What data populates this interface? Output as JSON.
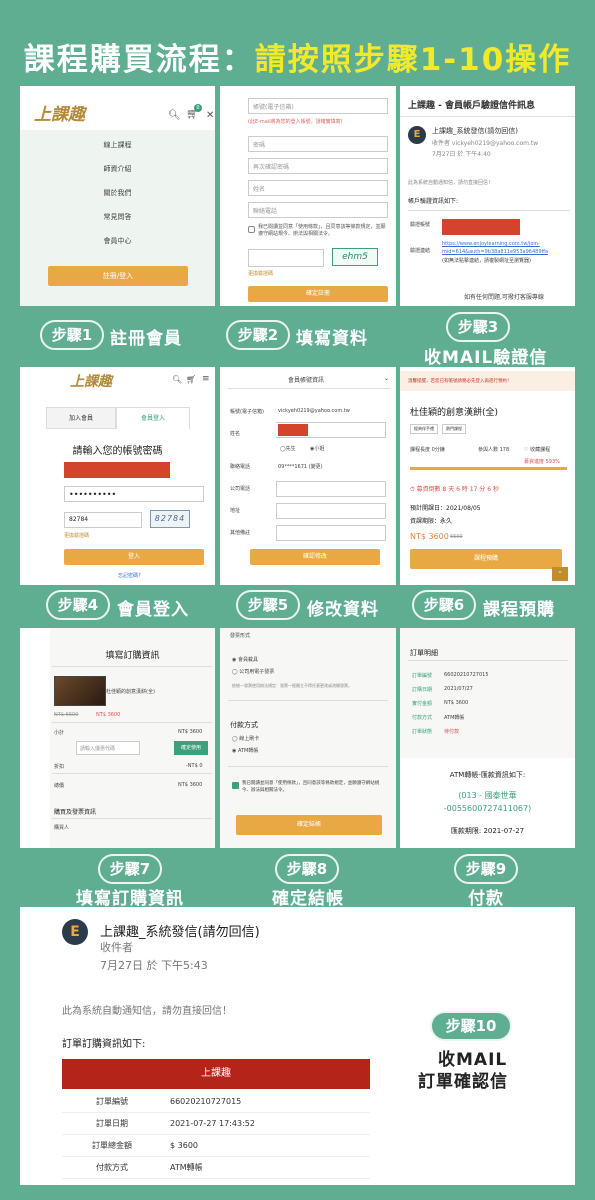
{
  "title": {
    "main": "課程購買流程：",
    "highlight": "請按照步驟1-10操作"
  },
  "steps": {
    "s1": {
      "pill": "步驟1",
      "label": "註冊會員"
    },
    "s2": {
      "pill": "步驟2",
      "label": "填寫資料"
    },
    "s3": {
      "pill": "步驟3",
      "label": "收MAIL驗證信"
    },
    "s4": {
      "pill": "步驟4",
      "label": "會員登入"
    },
    "s5": {
      "pill": "步驟5",
      "label": "修改資料"
    },
    "s6": {
      "pill": "步驟6",
      "label": "課程預購"
    },
    "s7": {
      "pill": "步驟7",
      "label": "填寫訂購資訊"
    },
    "s8": {
      "pill": "步驟8",
      "label": "確定結帳"
    },
    "s9": {
      "pill": "步驟9",
      "label": "付款"
    },
    "s10": {
      "pill": "步驟10",
      "label_line1": "收MAIL",
      "label_line2": "訂單確認信"
    }
  },
  "p1": {
    "logo": "上課趣",
    "cart_count": "0",
    "menu": [
      "線上課程",
      "師資介紹",
      "關於我們",
      "常見問答",
      "會員中心"
    ],
    "register": "註冊/登入"
  },
  "p2": {
    "account_placeholder": "帳號(電子信箱)",
    "hint": "(此E-mail將為您的登入帳號，請確實填寫)",
    "password": "密碼",
    "confirm": "再次確認密碼",
    "name": "姓名",
    "phone": "聯絡電話",
    "agree": "我已閱讀並同意「使用條款」，且同意該等條款規定，並願遵守網站規今、辦法與相關法令。",
    "captcha": "ehm5",
    "refresh": "更換驗證碼",
    "submit": "確定註冊"
  },
  "p3": {
    "subject": "上課趣 - 會員帳戶驗證信件訊息",
    "sender": "上課趣_系統發信(請勿回信)",
    "to": "收件者 vickyeh0219@yahoo.com.tw",
    "time": "7月27日 於 下午4:40",
    "auto": "此為系統自動通知信，請勿直接回信！",
    "info": "帳戶驗證資訊如下:",
    "row1": "驗證帳號",
    "row2": "驗證連結",
    "link1": "https://www.enjoylearning.com.tw/join-",
    "link2": "mid=614&auth=9b38a811e953a96489ffa",
    "note": "(如無法點擊連結，請複製網址至瀏覽器)",
    "help": "如有任何問題,可撥打客服專線"
  },
  "p4": {
    "logo": "上課趣",
    "cart_count": "0",
    "tab_join": "加入會員",
    "tab_login": "會員登入",
    "heading": "請輸入您的帳號密碼",
    "password_mask": "••••••••••",
    "code": "82784",
    "captcha": "82784",
    "refresh": "更換驗證碼",
    "login": "登入",
    "forgot": "忘記密碼?"
  },
  "p5": {
    "header": "會員帳號資訊",
    "account_label": "帳號(電子信箱)",
    "account_value": "vickyeh0219@yahoo.com.tw",
    "name_label": "姓名",
    "gender_m": "先生",
    "gender_f": "小姐",
    "phone_label": "聯絡電話",
    "phone_value": "09****1671 (變更)",
    "company_label": "公司電話",
    "address_label": "地址",
    "other_label": "其他備註",
    "submit": "確認修改"
  },
  "p6": {
    "notice": "溫馨提醒，若您已有帳號請務必先登入再進行預約！",
    "course": "杜佳穎的創意漢餅(全)",
    "tag1": "經典伴手禮",
    "tag2": "熱門課程",
    "stats": "課程長度 0分鐘",
    "students": "參與人數 178",
    "fav": "收藏課程",
    "progress": "募資進度 593%",
    "countdown": "募資倒數 8 天 6 時 17 分 6 秒",
    "start": "預計開課日：2021/08/05",
    "period": "資課期限：永久",
    "price": "NT$ 3600",
    "old_price": "6600",
    "buy": "課程預購"
  },
  "p7": {
    "heading": "填寫訂購資訊",
    "course": "杜佳穎的創意漢餅(全)",
    "old_price": "NT$ 6600",
    "price": "NT$ 3600",
    "subtotal_label": "小計",
    "subtotal": "NT$ 3600",
    "coupon_placeholder": "請輸入優惠代碼",
    "coupon_btn": "確定使用",
    "discount_label": "折扣",
    "discount": "-NT$ 0",
    "total_label": "總價",
    "total": "NT$ 3600",
    "buyer_section": "購買及發票資訊",
    "buyer_label": "購買人"
  },
  "p8": {
    "invoice_label": "發票形式",
    "invoice_opt1": "會員載具",
    "invoice_opt2": "公司用電子發票",
    "invoice_note": "依統一發票使用辦法規定：發票一經開立不得任意更改或改開發票。",
    "pay_label": "付款方式",
    "pay_opt1": "線上刷卡",
    "pay_opt2": "ATM轉帳",
    "agree": "我已閱讀並同意「使用條款」，且同意該等條款規定，並願遵守網站規今、辦法與相關法令。",
    "submit": "確定結帳"
  },
  "p9": {
    "heading": "訂單明細",
    "rows": [
      {
        "k": "訂單編號",
        "v": "66020210727015"
      },
      {
        "k": "訂購日期",
        "v": "2021/07/27"
      },
      {
        "k": "實付金額",
        "v": "NT$ 3600"
      },
      {
        "k": "付款方式",
        "v": "ATM轉帳"
      },
      {
        "k": "訂單狀態",
        "v": "待付款"
      }
    ],
    "atm_title": "ATM轉帳-匯款資訊如下:",
    "bank": "(013 - 國泰世華",
    "account": "-0055600727411067)",
    "deadline": "匯款期限: 2021-07-27"
  },
  "p10": {
    "sender": "上課趣_系統發信(請勿回信)",
    "to": "收件者",
    "time": "7月27日 於 下午5:43",
    "auto": "此為系統自動通知信，請勿直接回信！",
    "info": "訂單訂購資訊如下:",
    "banner": "上課趣",
    "rows": [
      {
        "k": "訂單編號",
        "v": "66020210727015"
      },
      {
        "k": "訂單日期",
        "v": "2021-07-27 17:43:52"
      },
      {
        "k": "訂單總金額",
        "v": "$ 3600"
      },
      {
        "k": "付款方式",
        "v": "ATM轉帳"
      }
    ]
  },
  "colors": {
    "bg": "#5fae92",
    "accent": "#e8a843",
    "title_highlight": "#f3e92c",
    "redact": "#d4432b"
  }
}
